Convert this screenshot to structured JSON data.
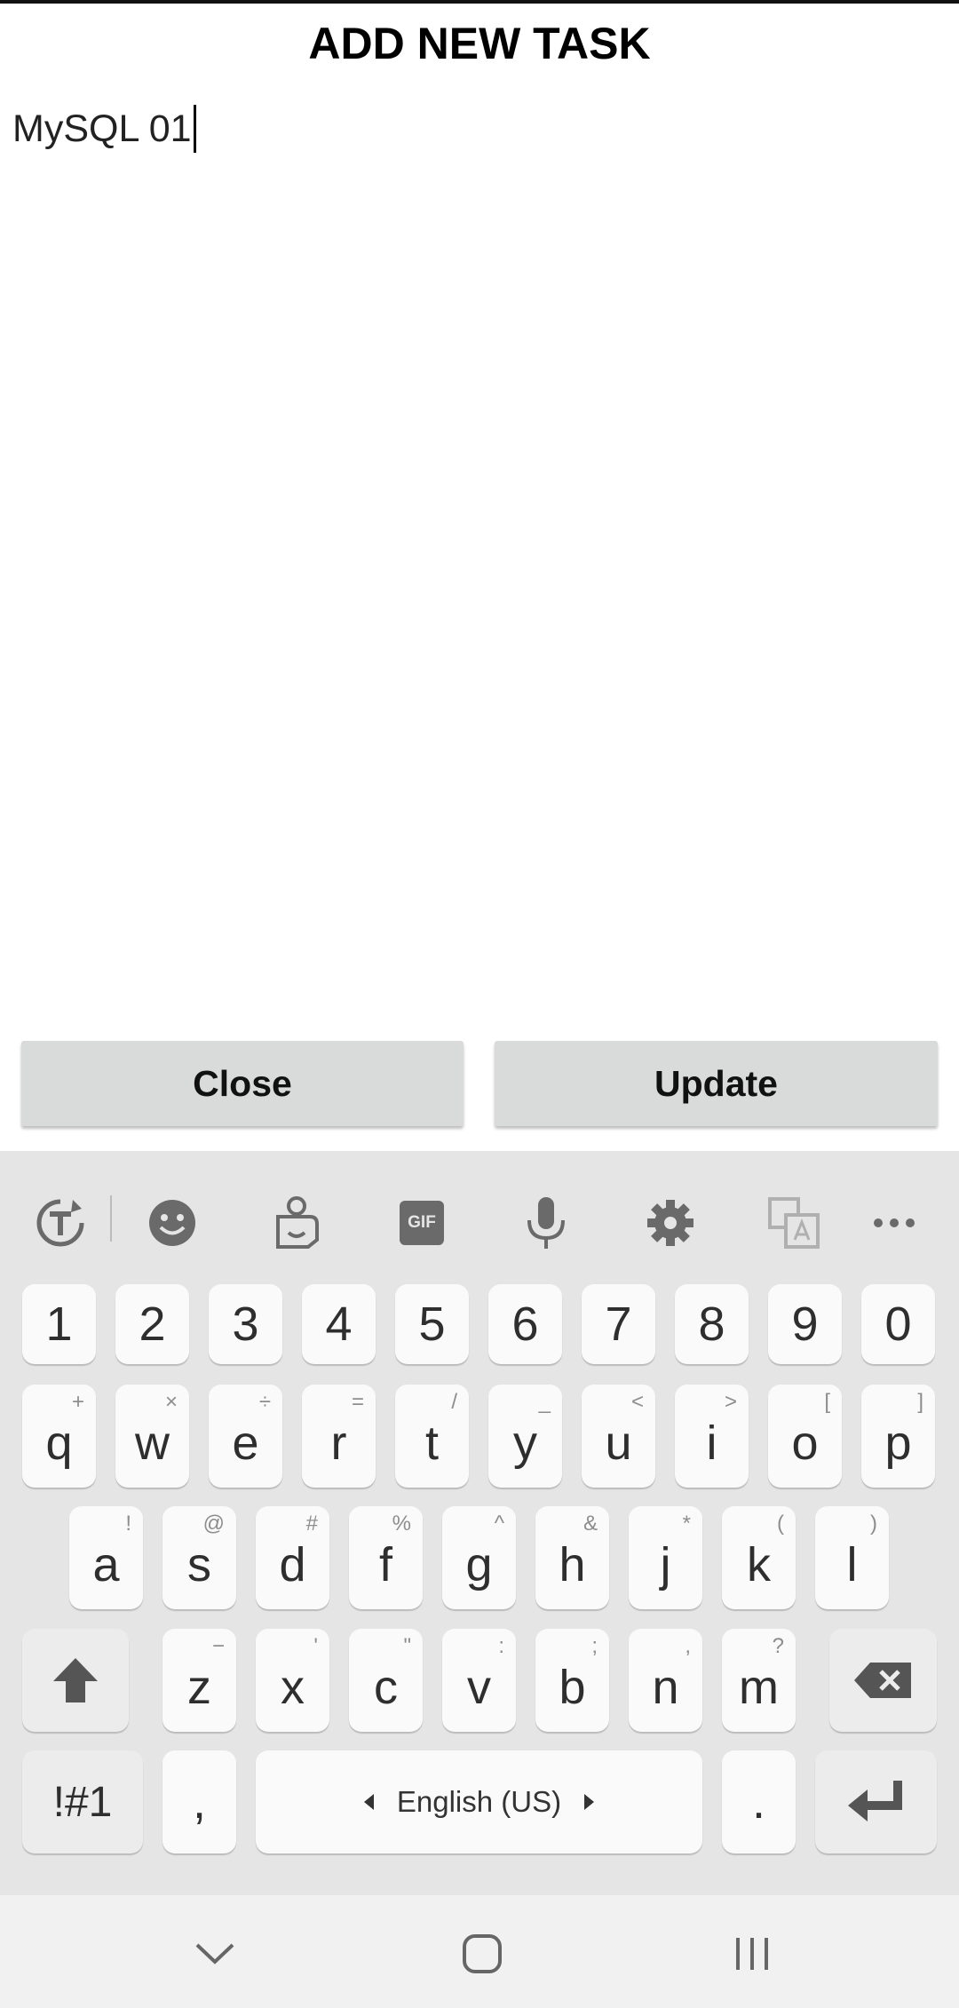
{
  "header": {
    "title": "ADD NEW TASK"
  },
  "task_input": {
    "value": "MySQL 01"
  },
  "buttons": {
    "close_label": "Close",
    "update_label": "Update"
  },
  "keyboard": {
    "toolbar_icons": [
      "text-recognition-icon",
      "emoji-icon",
      "sticker-icon",
      "gif-icon",
      "microphone-icon",
      "settings-gear-icon",
      "translate-icon",
      "more-icon"
    ],
    "toolbar": {
      "gif_label": "GIF"
    },
    "number_row": [
      "1",
      "2",
      "3",
      "4",
      "5",
      "6",
      "7",
      "8",
      "9",
      "0"
    ],
    "row1": [
      {
        "key": "q",
        "sec": "+"
      },
      {
        "key": "w",
        "sec": "×"
      },
      {
        "key": "e",
        "sec": "÷"
      },
      {
        "key": "r",
        "sec": "="
      },
      {
        "key": "t",
        "sec": "/"
      },
      {
        "key": "y",
        "sec": "_"
      },
      {
        "key": "u",
        "sec": "<"
      },
      {
        "key": "i",
        "sec": ">"
      },
      {
        "key": "o",
        "sec": "["
      },
      {
        "key": "p",
        "sec": "]"
      }
    ],
    "row2": [
      {
        "key": "a",
        "sec": "!"
      },
      {
        "key": "s",
        "sec": "@"
      },
      {
        "key": "d",
        "sec": "#"
      },
      {
        "key": "f",
        "sec": "%"
      },
      {
        "key": "g",
        "sec": "^"
      },
      {
        "key": "h",
        "sec": "&"
      },
      {
        "key": "j",
        "sec": "*"
      },
      {
        "key": "k",
        "sec": "("
      },
      {
        "key": "l",
        "sec": ")"
      }
    ],
    "row3": [
      {
        "key": "z",
        "sec": "−"
      },
      {
        "key": "x",
        "sec": "'"
      },
      {
        "key": "c",
        "sec": "\""
      },
      {
        "key": "v",
        "sec": ":"
      },
      {
        "key": "b",
        "sec": ";"
      },
      {
        "key": "n",
        "sec": ","
      },
      {
        "key": "m",
        "sec": "?"
      }
    ],
    "symbols_label": "!#1",
    "comma_label": ",",
    "space_label": "English (US)",
    "period_label": ".",
    "colors": {
      "background": "#e5e5e5",
      "key": "#fafafa",
      "key_dark": "#ececec"
    }
  },
  "navbar": {
    "icons": [
      "nav-down-icon",
      "home-icon",
      "recents-icon"
    ]
  }
}
